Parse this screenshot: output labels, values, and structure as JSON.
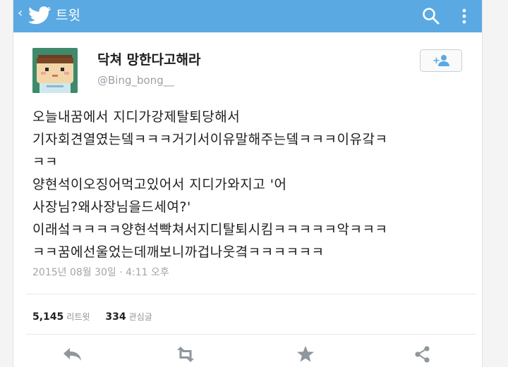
{
  "topbar": {
    "back_glyph": "‹",
    "title": "트윗",
    "icons": [
      "twitter-bird-icon",
      "search-icon",
      "more-vertical-icon"
    ],
    "color": "#5aa9e3"
  },
  "tweet": {
    "display_name": "닥쳐 망한다고해라",
    "handle": "@Bing_bong__",
    "lines": [
      "오늘내꿈에서 지디가강제탈퇴당해서",
      "기자회견열였는뎈ㅋㅋㅋ거기서이유말해주는뎈ㅋㅋㅋ이유갘ㅋ",
      "ㅋㅋ",
      "양현석이오징어먹고있어서 지디가와지고 '어",
      "사장님?왜사장님을드세여?'",
      "이래섴ㅋㅋㅋㅋ양현석빡쳐서지디탈퇴시킴ㅋㅋㅋㅋㅋ악ㅋㅋㅋ",
      "ㅋㅋ꿈에선울었는데깨보니까겁나웃곀ㅋㅋㅋㅋㅋㅋ"
    ],
    "timestamp": "2015년 08월 30일 · 4:11 오후"
  },
  "stats": {
    "retweets": "5,145",
    "retweets_label": "리트윗",
    "favorites": "334",
    "favorites_label": "관심글"
  },
  "actions": [
    "reply-icon",
    "retweet-icon",
    "favorite-star-icon",
    "share-icon"
  ],
  "colors": {
    "action_icon": "#8f969c",
    "text": "#202020",
    "meta": "#a0a6ab"
  }
}
